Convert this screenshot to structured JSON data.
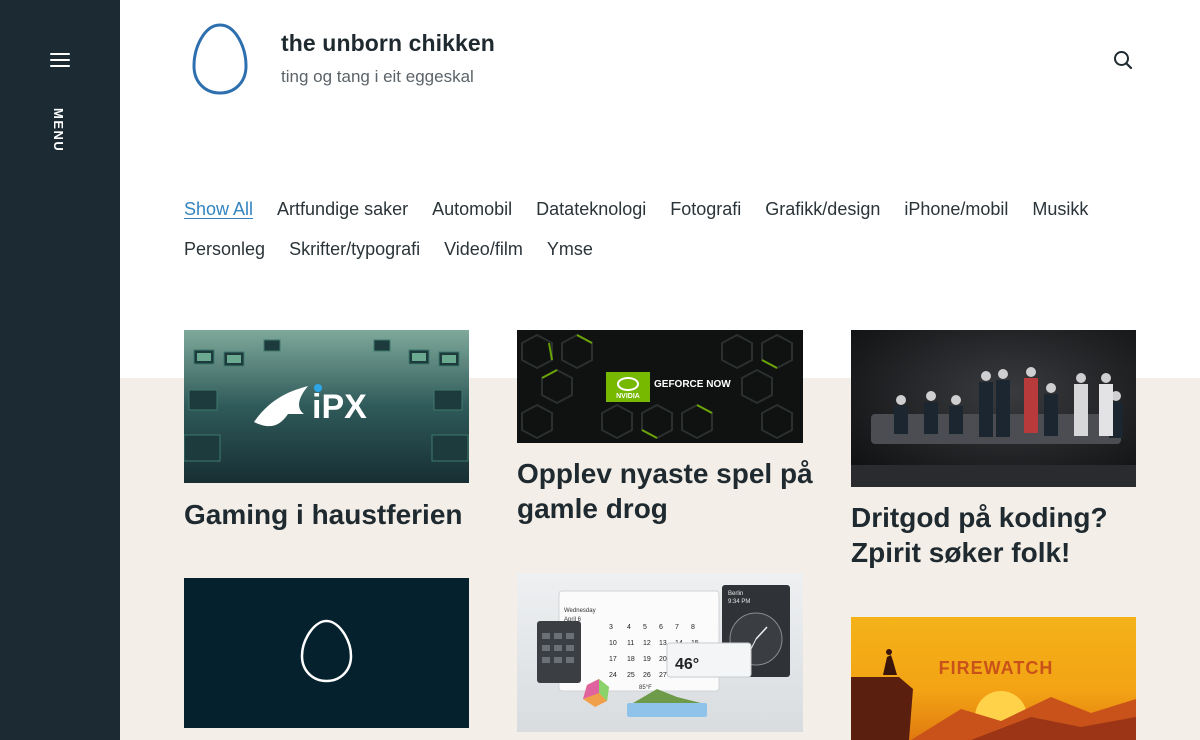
{
  "sidebar": {
    "menu_label": "MENU"
  },
  "header": {
    "title": "the unborn chikken",
    "description": "ting og tang i eit eggeskal"
  },
  "filters": {
    "row1": [
      "Show All",
      "Artfundige saker",
      "Automobil",
      "Datateknologi",
      "Fotografi",
      "Grafikk/design",
      "iPhone/mobil",
      "Musikk"
    ],
    "row2": [
      "Personleg",
      "Skrifter/typografi",
      "Video/film",
      "Ymse"
    ]
  },
  "posts": [
    {
      "title": "Gaming i haustferien",
      "logo_text": "iPX"
    },
    {
      "title": "Opplev nyaste spel på gamle drog",
      "logo_text": "GEFORCE NOW",
      "brand": "NVIDIA"
    },
    {
      "title": "Dritgod på koding? Zpirit søker folk!"
    },
    {
      "title": ""
    },
    {
      "title": "",
      "calendar": {
        "day": "Wednesday",
        "date": "April 6",
        "city": "Berlin",
        "time": "9:34 PM",
        "temp": "46°",
        "temp2": "85°F"
      }
    },
    {
      "title": "",
      "logo_text": "FIREWATCH"
    }
  ],
  "colors": {
    "sidebar": "#1c2b33",
    "accent": "#3384bf",
    "band": "#f3eee7",
    "logo": "#2e6fb0"
  }
}
